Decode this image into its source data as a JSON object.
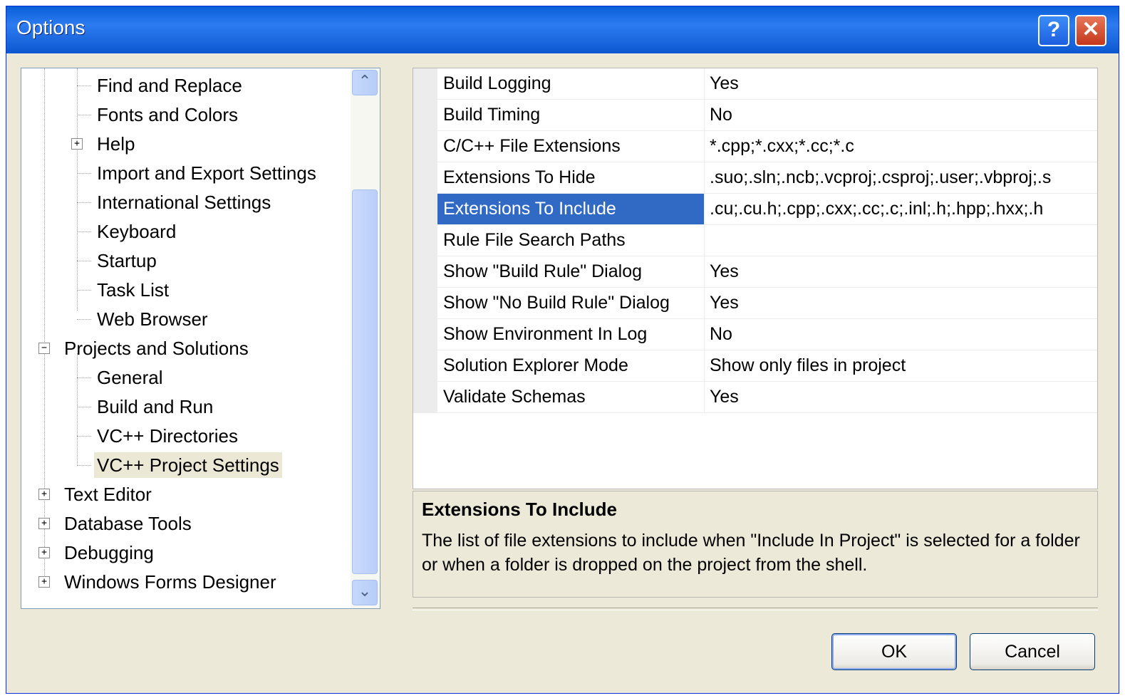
{
  "window": {
    "title": "Options",
    "help_glyph": "?",
    "close_glyph": "✕"
  },
  "tree": {
    "items": [
      {
        "label": "Find and Replace"
      },
      {
        "label": "Fonts and Colors"
      },
      {
        "label": "Help",
        "expander": "+"
      },
      {
        "label": "Import and Export Settings"
      },
      {
        "label": "International Settings"
      },
      {
        "label": "Keyboard"
      },
      {
        "label": "Startup"
      },
      {
        "label": "Task List"
      },
      {
        "label": "Web Browser"
      },
      {
        "label": "Projects and Solutions",
        "expander": "−"
      },
      {
        "label": "General"
      },
      {
        "label": "Build and Run"
      },
      {
        "label": "VC++ Directories"
      },
      {
        "label": "VC++ Project Settings",
        "selected": true
      },
      {
        "label": "Text Editor",
        "expander": "+"
      },
      {
        "label": "Database Tools",
        "expander": "+"
      },
      {
        "label": "Debugging",
        "expander": "+"
      },
      {
        "label": "Windows Forms Designer",
        "expander": "+"
      }
    ],
    "scroll_up_glyph": "⌃",
    "scroll_down_glyph": "⌄"
  },
  "properties": [
    {
      "name": "Build Logging",
      "value": "Yes"
    },
    {
      "name": "Build Timing",
      "value": "No"
    },
    {
      "name": "C/C++ File Extensions",
      "value": "*.cpp;*.cxx;*.cc;*.c"
    },
    {
      "name": "Extensions To Hide",
      "value": ".suo;.sln;.ncb;.vcproj;.csproj;.user;.vbproj;.s"
    },
    {
      "name": "Extensions To Include",
      "value": ".cu;.cu.h;.cpp;.cxx;.cc;.c;.inl;.h;.hpp;.hxx;.h",
      "selected": true
    },
    {
      "name": "Rule File Search Paths",
      "value": ""
    },
    {
      "name": "Show \"Build Rule\" Dialog",
      "value": "Yes"
    },
    {
      "name": "Show \"No Build Rule\" Dialog",
      "value": "Yes"
    },
    {
      "name": "Show Environment In Log",
      "value": "No"
    },
    {
      "name": "Solution Explorer Mode",
      "value": "Show only files in project"
    },
    {
      "name": "Validate Schemas",
      "value": "Yes"
    }
  ],
  "description": {
    "title": "Extensions To Include",
    "text": "The list of file extensions to include when \"Include In Project\" is selected for a folder or when a folder is dropped on the project from the shell."
  },
  "buttons": {
    "ok": "OK",
    "cancel": "Cancel"
  },
  "colors": {
    "selection": "#316ac5",
    "titlebar": "#0a5fd8",
    "dialog_bg": "#ece9d8"
  }
}
